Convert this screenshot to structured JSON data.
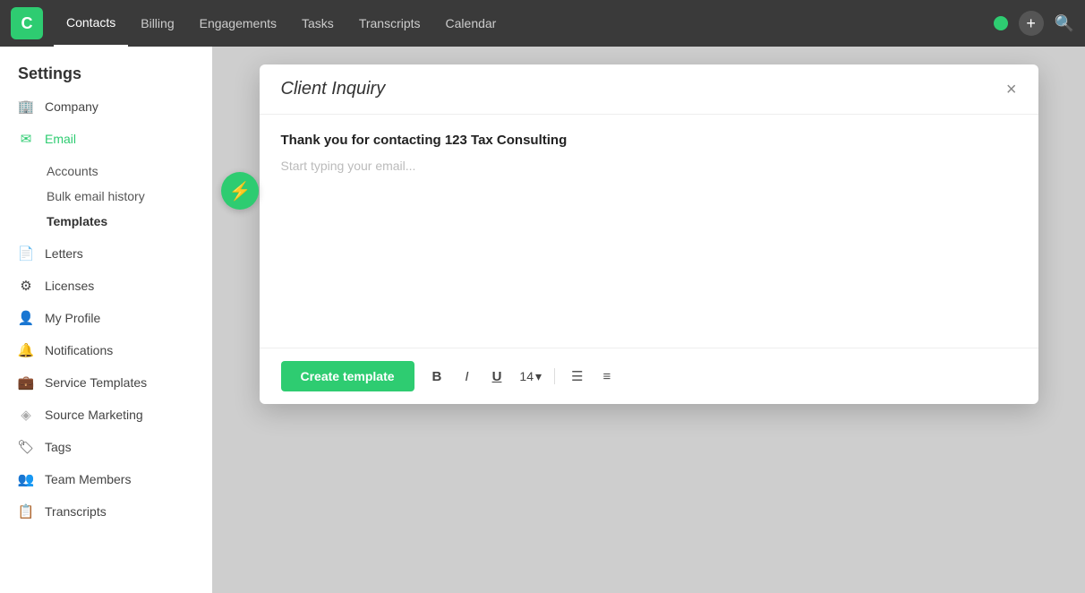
{
  "app": {
    "logo": "C",
    "nav": {
      "items": [
        {
          "label": "Contacts",
          "active": true
        },
        {
          "label": "Billing",
          "active": false
        },
        {
          "label": "Engagements",
          "active": false
        },
        {
          "label": "Tasks",
          "active": false
        },
        {
          "label": "Transcripts",
          "active": false
        },
        {
          "label": "Calendar",
          "active": false
        }
      ]
    }
  },
  "sidebar": {
    "title": "Settings",
    "sections": [
      {
        "icon": "🏢",
        "label": "Company",
        "active": false
      },
      {
        "icon": "✉",
        "label": "Email",
        "active": true
      }
    ],
    "email_sub": [
      {
        "label": "Accounts",
        "active": false
      },
      {
        "label": "Bulk email history",
        "active": false
      },
      {
        "label": "Templates",
        "active": true
      }
    ],
    "bottom_items": [
      {
        "icon": "📄",
        "label": "Letters"
      },
      {
        "icon": "⚙",
        "label": "Licenses"
      },
      {
        "icon": "👤",
        "label": "My Profile"
      },
      {
        "icon": "🔔",
        "label": "Notifications"
      },
      {
        "icon": "💼",
        "label": "Service Templates"
      },
      {
        "icon": "◈",
        "label": "Source Marketing"
      },
      {
        "icon": "🏷",
        "label": "Tags"
      },
      {
        "icon": "👥",
        "label": "Team Members"
      },
      {
        "icon": "📋",
        "label": "Transcripts"
      }
    ]
  },
  "modal": {
    "title": "Client Inquiry",
    "close_label": "×",
    "subject": "Thank you for contacting 123 Tax Consulting",
    "body_placeholder": "Start typing your email...",
    "footer": {
      "create_btn": "Create template",
      "bold_label": "B",
      "italic_label": "I",
      "underline_label": "U",
      "font_size": "14",
      "font_size_arrow": "▾"
    }
  },
  "lightning": "⚡"
}
